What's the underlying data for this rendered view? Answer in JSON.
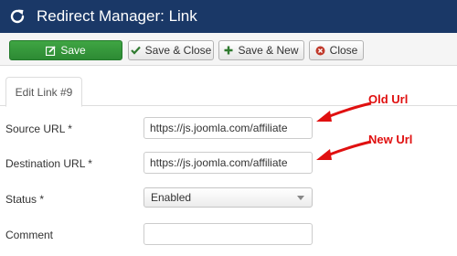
{
  "header": {
    "title": "Redirect Manager: Link",
    "icon": "refresh-icon"
  },
  "toolbar": {
    "save_label": "Save",
    "save_close_label": "Save & Close",
    "save_new_label": "Save & New",
    "close_label": "Close"
  },
  "tabs": [
    {
      "label": "Edit Link #9"
    }
  ],
  "form": {
    "source_url": {
      "label": "Source URL *",
      "value": "https://js.joomla.com/affiliate"
    },
    "destination_url": {
      "label": "Destination URL *",
      "value": "https://js.joomla.com/affiliate"
    },
    "status": {
      "label": "Status *",
      "value": "Enabled"
    },
    "comment": {
      "label": "Comment",
      "value": ""
    }
  },
  "annotations": {
    "old_url": "Old Url",
    "new_url": "New Url"
  },
  "colors": {
    "header_bg": "#1a3867",
    "save_green": "#2d8a34",
    "annotation_red": "#e01010"
  }
}
